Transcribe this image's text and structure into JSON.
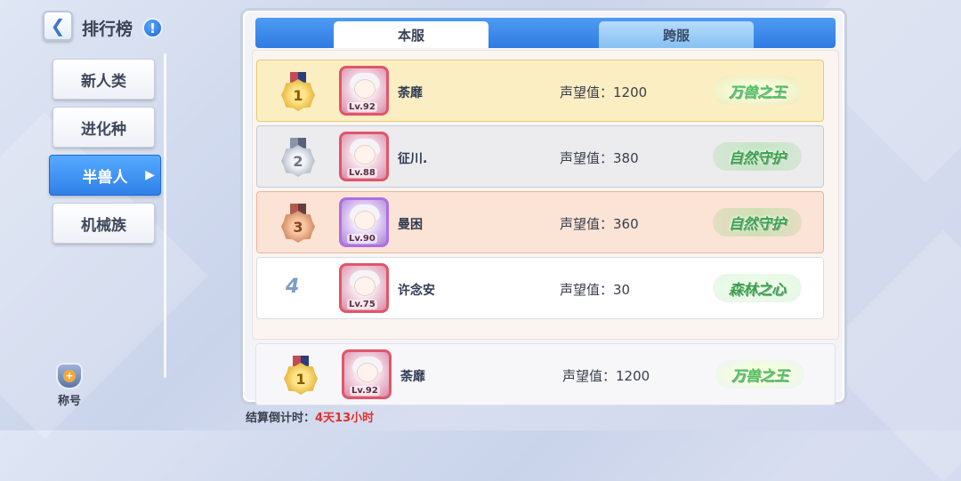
{
  "header": {
    "title": "排行榜",
    "back_icon": "chevron-left-icon",
    "info_icon": "exclamation-icon"
  },
  "sidebar": {
    "items": [
      {
        "label": "新人类",
        "active": false
      },
      {
        "label": "进化种",
        "active": false
      },
      {
        "label": "半兽人",
        "active": true
      },
      {
        "label": "机械族",
        "active": false
      }
    ],
    "title_badge_label": "称号"
  },
  "tabs": [
    {
      "label": "本服",
      "active": true
    },
    {
      "label": "跨服",
      "active": false
    }
  ],
  "rankings": [
    {
      "rank": "1",
      "medal": "gold",
      "name": "荼靡",
      "level": "Lv.92",
      "score": "声望值：1200",
      "title": "万兽之王"
    },
    {
      "rank": "2",
      "medal": "silver",
      "name": "征川.",
      "level": "Lv.88",
      "score": "声望值：380",
      "title": "自然守护"
    },
    {
      "rank": "3",
      "medal": "bronze",
      "name": "曼困",
      "level": "Lv.90",
      "score": "声望值：360",
      "title": "自然守护"
    },
    {
      "rank": "4",
      "medal": "none",
      "name": "许念安",
      "level": "Lv.75",
      "score": "声望值：30",
      "title": "森林之心"
    }
  ],
  "my_entry": {
    "rank": "1",
    "name": "荼靡",
    "level": "Lv.92",
    "score": "声望值：1200",
    "title": "万兽之王"
  },
  "countdown": {
    "label": "结算倒计时：",
    "value": "4天13小时"
  },
  "colors": {
    "accent": "#2f80e8",
    "countdown_value": "#e0302c"
  }
}
